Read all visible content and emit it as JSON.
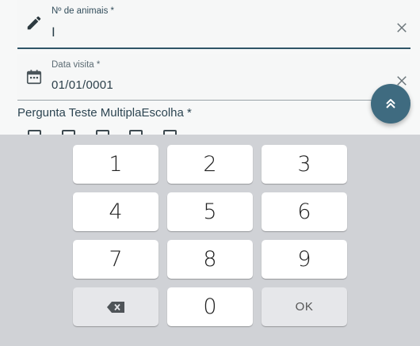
{
  "form": {
    "animais": {
      "label": "Nº de animais *",
      "value": "I",
      "icon": "pencil-icon",
      "clear_icon": "close-icon"
    },
    "data_visita": {
      "label": "Data visita *",
      "value": "01/01/0001",
      "icon": "calendar-icon",
      "clear_icon": "close-icon"
    },
    "question": {
      "label": "Pergunta Teste MultiplaEscolha *",
      "options_visible": 5
    },
    "fab_icon": "double-chevron-up-icon"
  },
  "keypad": {
    "keys": [
      "1",
      "2",
      "3",
      "4",
      "5",
      "6",
      "7",
      "8",
      "9",
      "",
      "0",
      "OK"
    ],
    "backspace_icon": "backspace-icon"
  },
  "colors": {
    "accent": "#2f5567",
    "fab": "#3f6b80",
    "keypad_bg": "#d0d2d6",
    "key_bg": "#ffffff",
    "func_key_bg": "#e6e7ea"
  }
}
